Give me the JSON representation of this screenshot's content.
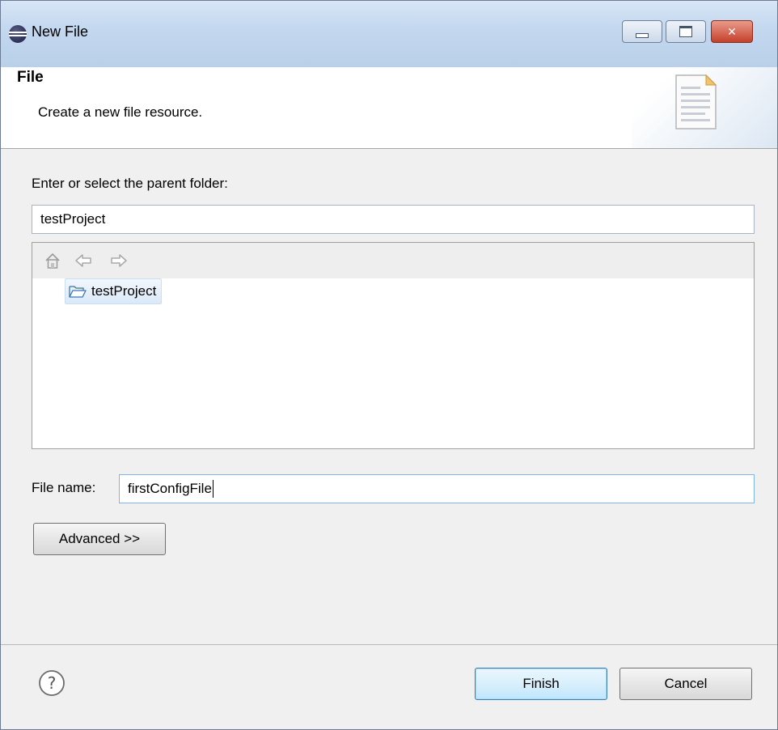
{
  "window": {
    "title": "New File"
  },
  "banner": {
    "title": "File",
    "description": "Create a new file resource."
  },
  "parent_folder": {
    "label": "Enter or select the parent folder:",
    "value": "testProject"
  },
  "tree": {
    "items": [
      {
        "label": "testProject",
        "icon": "open-folder-icon",
        "selected": true
      }
    ],
    "toolbar_icons": [
      "home-icon",
      "back-arrow-icon",
      "forward-arrow-icon"
    ]
  },
  "file_name": {
    "label": "File name:",
    "value": "firstConfigFile"
  },
  "buttons": {
    "advanced": "Advanced >>",
    "finish": "Finish",
    "cancel": "Cancel"
  },
  "colors": {
    "accent": "#3c7fb1",
    "titlebar": "#c4d8ef",
    "close": "#c4402a"
  }
}
